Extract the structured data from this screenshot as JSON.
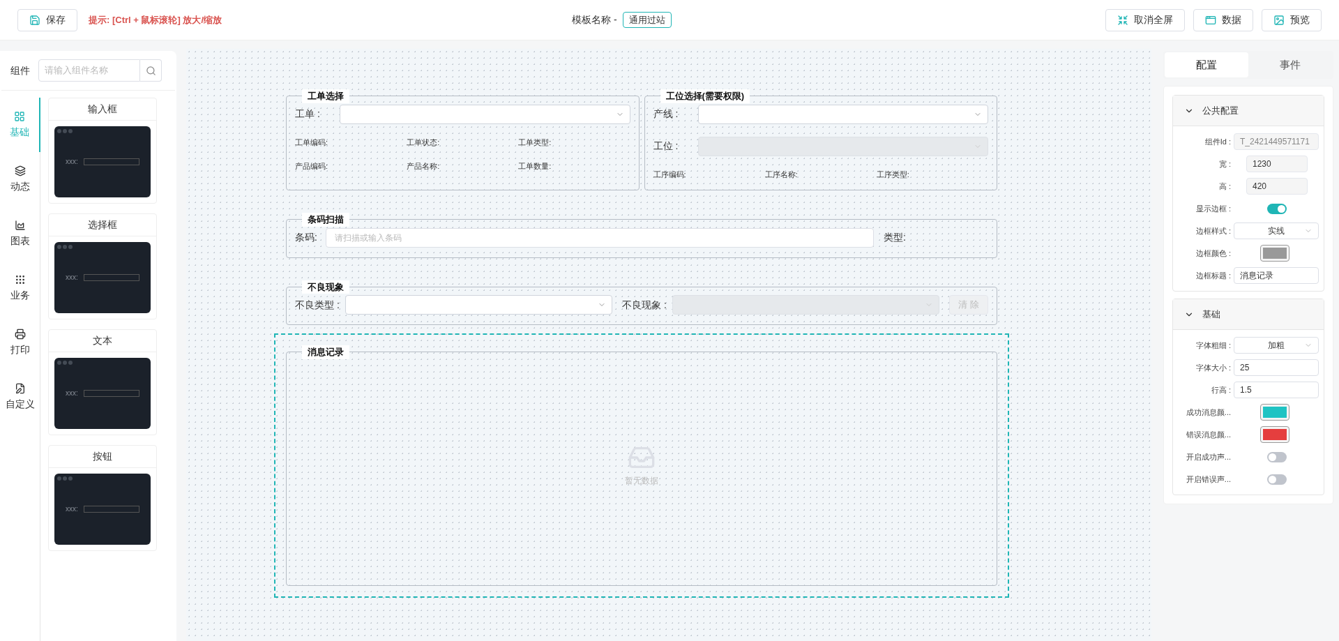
{
  "toolbar": {
    "save_button": "保存",
    "hint": "提示: [Ctrl + 鼠标滚轮] 放大/缩放",
    "template_label": "模板名称 -",
    "template_name": "通用过站",
    "actions": [
      {
        "label": "取消全屏"
      },
      {
        "label": "数据"
      },
      {
        "label": "预览"
      }
    ]
  },
  "components_panel": {
    "label": "组件",
    "search": {
      "placeholder": "请输入组件名称"
    },
    "categories": [
      {
        "label": "基础",
        "selected": true
      },
      {
        "label": "动态",
        "selected": false
      },
      {
        "label": "图表",
        "selected": false
      },
      {
        "label": "业务",
        "selected": false
      },
      {
        "label": "打印",
        "selected": false
      },
      {
        "label": "自定义",
        "selected": false
      }
    ],
    "items": [
      {
        "title": "输入框",
        "preview_label": "xxx:"
      },
      {
        "title": "选择框",
        "preview_label": "xxx:"
      },
      {
        "title": "文本",
        "preview_label": "xxx:"
      },
      {
        "title": "按钮",
        "preview_label": "xxx:"
      }
    ]
  },
  "canvas": {
    "rows": [
      [
        {
          "kind": "form",
          "title": "工单选择",
          "rows": [
            {
              "kind": "controls",
              "controls": [
                {
                  "kind": "select",
                  "label": "工单 :",
                  "disabled": false
                }
              ]
            },
            {
              "kind": "info",
              "labels": [
                "工单编码:",
                "工单状态:",
                "工单类型:"
              ]
            },
            {
              "kind": "info",
              "labels": [
                "产品编码:",
                "产品名称:",
                "工单数量:"
              ]
            }
          ]
        },
        {
          "kind": "form",
          "title": "工位选择(需要权限)",
          "rows": [
            {
              "kind": "controls",
              "controls": [
                {
                  "kind": "select",
                  "label": "产线 :",
                  "disabled": false
                }
              ]
            },
            {
              "kind": "controls",
              "controls": [
                {
                  "kind": "select",
                  "label": "工位 :",
                  "disabled": true
                }
              ]
            },
            {
              "kind": "info",
              "labels": [
                "工序编码:",
                "工序名称:",
                "工序类型:"
              ]
            }
          ]
        }
      ],
      [
        {
          "kind": "form",
          "title": "条码扫描",
          "rows": [
            {
              "kind": "controls",
              "controls": [
                {
                  "kind": "input",
                  "label": "条码:",
                  "placeholder": "请扫描或输入条码"
                },
                {
                  "kind": "text",
                  "label": "类型:"
                }
              ]
            }
          ]
        }
      ],
      [
        {
          "kind": "form",
          "title": "不良现象",
          "rows": [
            {
              "kind": "controls",
              "controls": [
                {
                  "kind": "select",
                  "label": "不良类型 :",
                  "disabled": false
                },
                {
                  "kind": "select",
                  "label": "不良现象 :",
                  "disabled": true
                },
                {
                  "kind": "button",
                  "label": "清 除",
                  "disabled": true
                }
              ]
            }
          ]
        }
      ],
      [
        {
          "kind": "log",
          "title": "消息记录",
          "selected": true,
          "empty_text": "暂无数据"
        }
      ]
    ]
  },
  "config_panel": {
    "tabs": [
      {
        "label": "配置",
        "selected": true
      },
      {
        "label": "事件",
        "selected": false
      }
    ],
    "sections": [
      {
        "title": "公共配置",
        "expanded": true,
        "rows": [
          {
            "kind": "input",
            "label": "组件Id :",
            "value": "T_2421449571171",
            "disabled": true
          },
          {
            "kind": "number",
            "label": "宽 :",
            "value": "1230"
          },
          {
            "kind": "number",
            "label": "高 :",
            "value": "420"
          },
          {
            "kind": "toggle",
            "label": "显示边框 :",
            "on": true
          },
          {
            "kind": "select",
            "label": "边框样式 :",
            "value": "实线"
          },
          {
            "kind": "color",
            "label": "边框颜色 :",
            "color": "#999999"
          },
          {
            "kind": "input",
            "label": "边框标题 :",
            "value": "消息记录",
            "disabled": false
          }
        ]
      },
      {
        "title": "基础",
        "expanded": true,
        "rows": [
          {
            "kind": "select",
            "label": "字体粗细 :",
            "value": "加粗"
          },
          {
            "kind": "input",
            "label": "字体大小 :",
            "value": "25",
            "disabled": false
          },
          {
            "kind": "input",
            "label": "行高 :",
            "value": "1.5",
            "disabled": false
          },
          {
            "kind": "color",
            "label": "成功消息颜...",
            "color": "#1fc3c3"
          },
          {
            "kind": "color",
            "label": "错误消息颜...",
            "color": "#e53e3e"
          },
          {
            "kind": "toggle",
            "label": "开启成功声...",
            "on": false
          },
          {
            "kind": "toggle",
            "label": "开启错误声...",
            "on": false
          }
        ]
      }
    ]
  }
}
